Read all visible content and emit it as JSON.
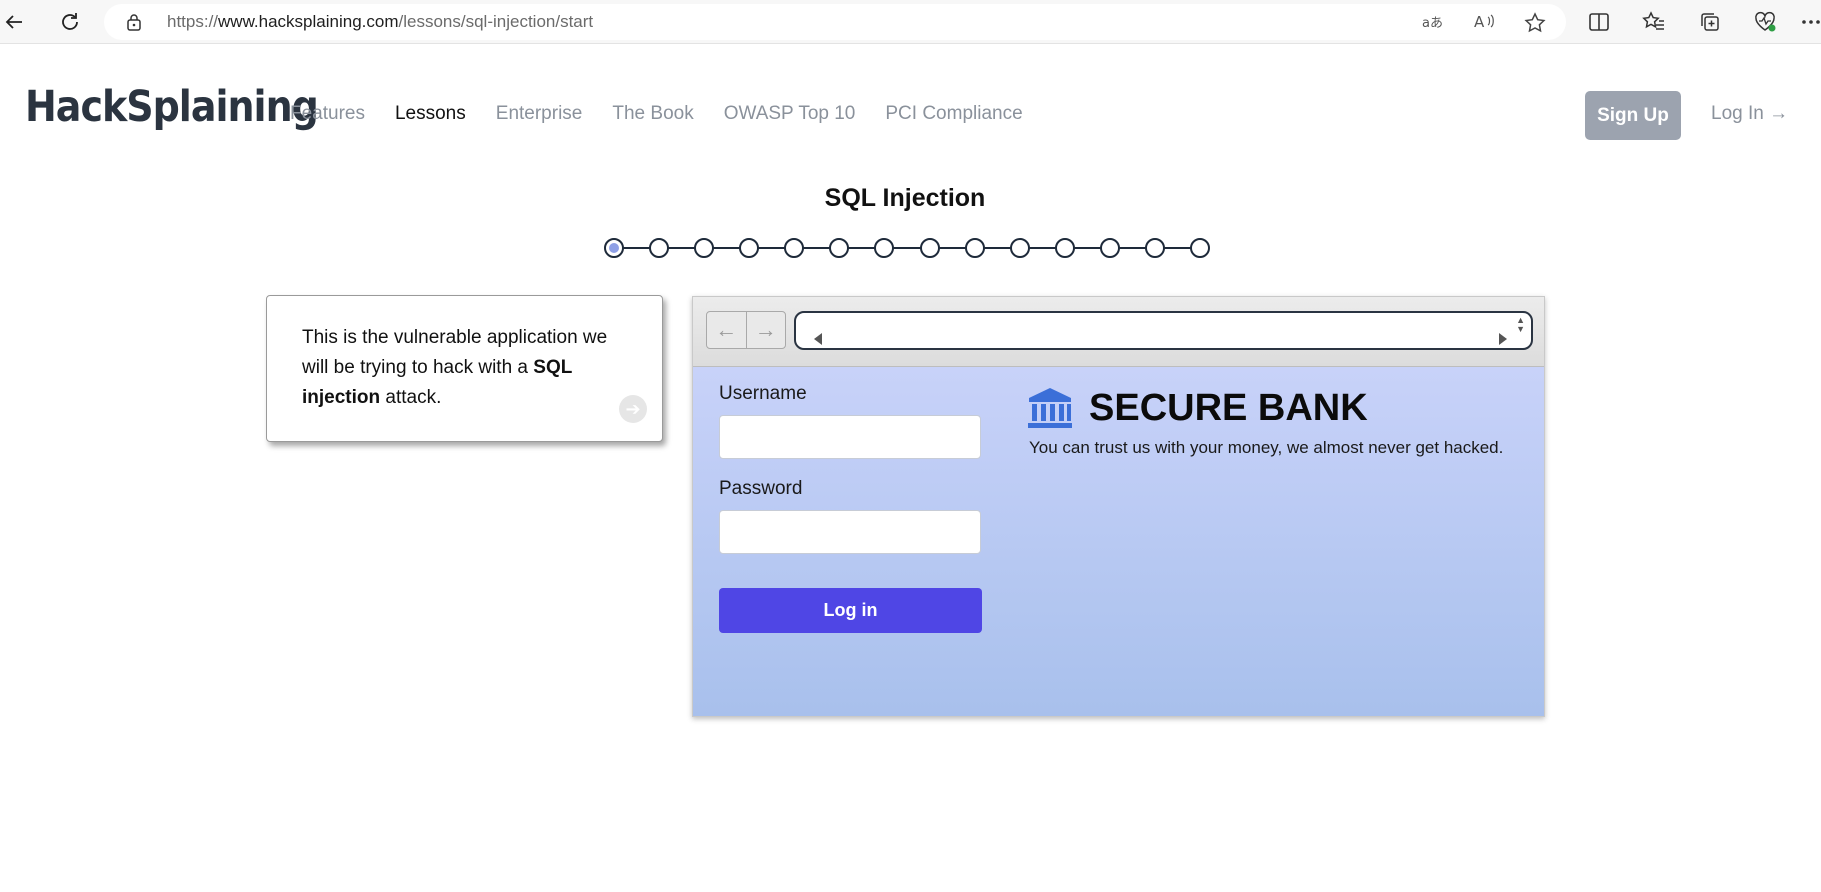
{
  "browser": {
    "url_prefix": "https://",
    "url_host": "www.hacksplaining.com",
    "url_path": "/lessons/sql-injection/start",
    "icons": [
      "back-icon",
      "refresh-icon",
      "lock-icon",
      "translate-icon",
      "read-aloud-icon",
      "favorite-star-icon",
      "split-screen-icon",
      "favorites-icon",
      "collections-icon",
      "browser-essentials-icon",
      "more-icon"
    ]
  },
  "site": {
    "logo": "HackSplaining",
    "nav": [
      {
        "label": "Features",
        "active": false
      },
      {
        "label": "Lessons",
        "active": true
      },
      {
        "label": "Enterprise",
        "active": false
      },
      {
        "label": "The Book",
        "active": false
      },
      {
        "label": "OWASP Top 10",
        "active": false
      },
      {
        "label": "PCI Compliance",
        "active": false
      }
    ],
    "signup_label": "Sign Up",
    "login_label": "Log In →"
  },
  "lesson": {
    "title": "SQL Injection",
    "total_steps": 14,
    "current_step": 1
  },
  "card": {
    "text_before": "This is the vulnerable application we will be trying to hack with a ",
    "text_bold": "SQL injection",
    "text_after": " attack."
  },
  "mock_browser": {
    "back_glyph": "←",
    "forward_glyph": "→",
    "url_value": ""
  },
  "bank": {
    "username_label": "Username",
    "password_label": "Password",
    "username_value": "",
    "password_value": "",
    "login_button": "Log in",
    "title": "SECURE BANK",
    "tagline": "You can trust us with your money, we almost never get hacked.",
    "icon": "bank-icon",
    "accent_color": "#4f46e5",
    "icon_color": "#3b6fd8"
  }
}
